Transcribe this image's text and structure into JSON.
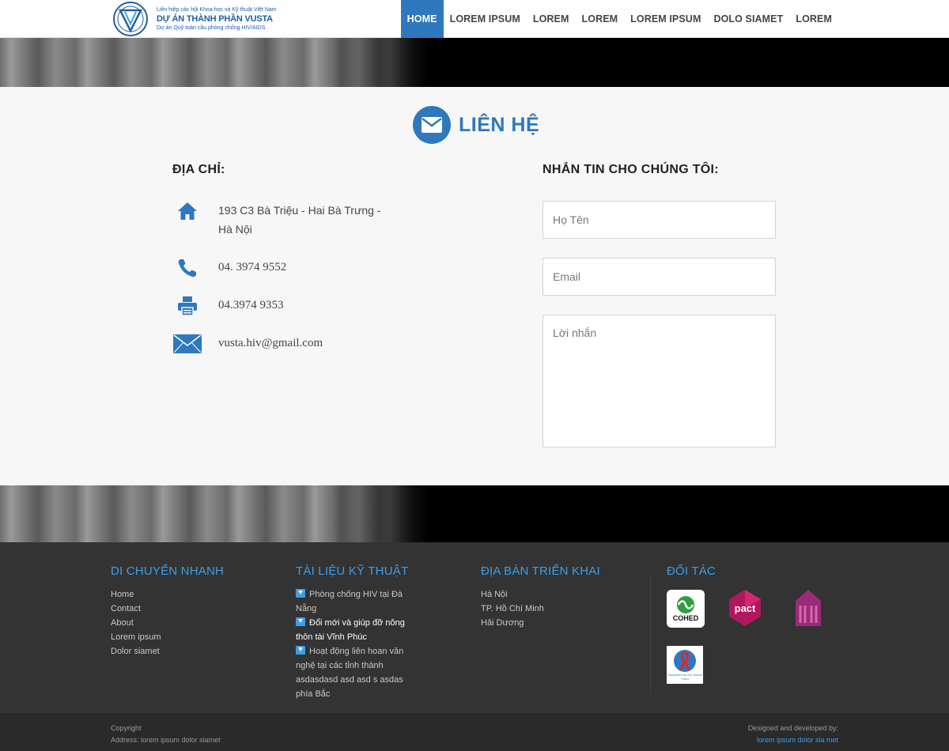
{
  "header": {
    "logo": {
      "line1": "Liên hiệp các hội Khoa học và Kỹ thuật Việt Nam",
      "line2": "DỰ ÁN THÀNH PHẦN VUSTA",
      "line3": "Dự án Quỹ toàn cầu phòng chống HIV/AIDS"
    },
    "nav": [
      {
        "label": "HOME",
        "active": true
      },
      {
        "label": "LOREM IPSUM"
      },
      {
        "label": "LOREM"
      },
      {
        "label": "LOREM"
      },
      {
        "label": "LOREM IPSUM"
      },
      {
        "label": "DOLO SIAMET"
      },
      {
        "label": "LOREM"
      }
    ]
  },
  "contact": {
    "title": "LIÊN HỆ",
    "address_heading": "ĐỊA CHỈ:",
    "address": "193 C3 Bà Triệu - Hai Bà Trưng - Hà Nội",
    "phone": "04. 3974 9552",
    "fax": "04.3974 9353",
    "email": "vusta.hiv@gmail.com",
    "form_heading": "NHẮN TIN CHO CHÚNG TÔI:",
    "placeholders": {
      "name": "Họ Tên",
      "email": "Email",
      "message": "Lời nhắn"
    },
    "icons": [
      "home-icon",
      "phone-icon",
      "printer-icon",
      "envelope-icon"
    ]
  },
  "footer": {
    "quick_nav": {
      "heading": "DI CHUYỂN NHANH",
      "items": [
        "Home",
        "Contact",
        "About",
        "Lorem ipsum",
        "Dolor siamet"
      ]
    },
    "docs": {
      "heading": "TÀI LIỆU KỸ THUẬT",
      "items": [
        {
          "text": "Phòng chống HIV tại Đà Nẵng"
        },
        {
          "text": "Đổi mới và giúp đỡ nông thôn tài Vĩnh Phúc",
          "highlight": true
        },
        {
          "text": "Hoạt động liên hoan văn nghệ tại các tỉnh thành asdasdasd asd asd s asdas phía Bắc"
        }
      ]
    },
    "areas": {
      "heading": "ĐỊA BÀN TRIỂN KHAI",
      "items": [
        "Hà Nội",
        "TP. Hồ Chí Minh",
        "Hải Dương"
      ]
    },
    "partners": {
      "heading": "ĐỐI TÁC",
      "logos": [
        "COHED",
        "pact",
        "ISDS",
        "Supported by the Global Fund"
      ]
    },
    "copyright": "Copyright",
    "address": "Address: lorem ipsum dolor siamet",
    "designed_by": "Designed and developed by:",
    "developer": "lorem ipsum dolor sia met"
  },
  "colors": {
    "accent": "#2f78bd",
    "footer_heading": "#3d9ee8",
    "footer_bg": "#333333"
  }
}
